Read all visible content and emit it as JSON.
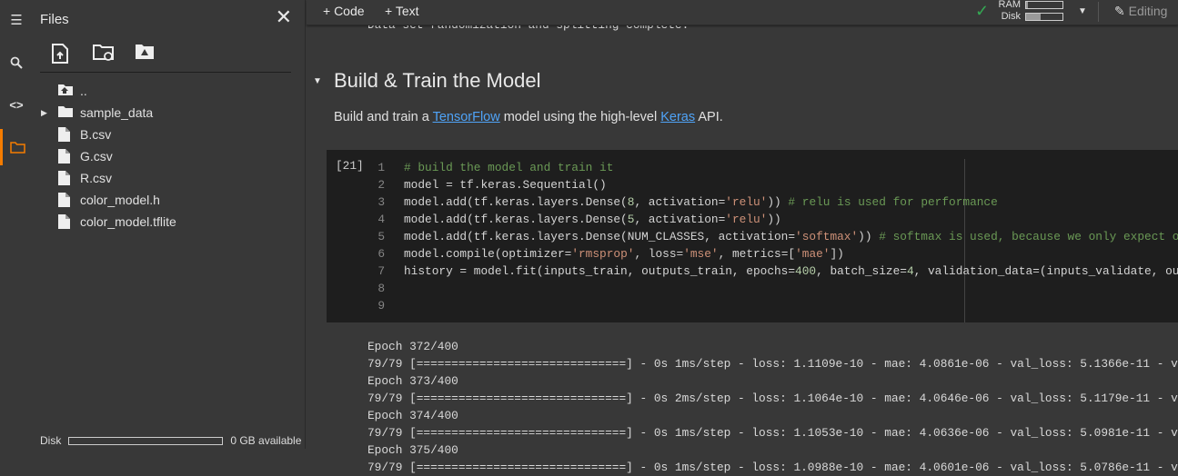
{
  "rail": {
    "icons": [
      "menu-icon",
      "search-icon",
      "code-icon",
      "folder-icon"
    ]
  },
  "files": {
    "title": "Files",
    "items": [
      {
        "name": "..",
        "type": "parent"
      },
      {
        "name": "sample_data",
        "type": "folder"
      },
      {
        "name": "B.csv",
        "type": "file"
      },
      {
        "name": "G.csv",
        "type": "file"
      },
      {
        "name": "R.csv",
        "type": "file"
      },
      {
        "name": "color_model.h",
        "type": "file"
      },
      {
        "name": "color_model.tflite",
        "type": "file"
      }
    ],
    "disk_label": "Disk",
    "disk_available": "0 GB available",
    "disk_used_fraction": 0
  },
  "toolbar": {
    "add_code": "+ Code",
    "add_text": "+ Text",
    "ram_label": "RAM",
    "disk_label": "Disk",
    "ram_fraction": 0.05,
    "disk_fraction": 0.4,
    "editing": "Editing",
    "status_color": "#34a853"
  },
  "notebook": {
    "prev_output": "Data set randomization and splitting complete.",
    "heading": "Build & Train the Model",
    "para": {
      "before": "Build and train a ",
      "link1": "TensorFlow",
      "middle": " model using the high-level ",
      "link2": "Keras",
      "after": " API."
    },
    "cell": {
      "exec_count": "[21]",
      "lines": [
        [
          [
            "c",
            "# build the model and train it"
          ]
        ],
        [
          [
            "t",
            "model = tf.keras.Sequential()"
          ]
        ],
        [
          [
            "t",
            "model.add(tf.keras.layers.Dense("
          ],
          [
            "n",
            "8"
          ],
          [
            "t",
            ", activation="
          ],
          [
            "s",
            "'relu'"
          ],
          [
            "t",
            ")) "
          ],
          [
            "c",
            "# relu is used for performance"
          ]
        ],
        [
          [
            "t",
            "model.add(tf.keras.layers.Dense("
          ],
          [
            "n",
            "5"
          ],
          [
            "t",
            ", activation="
          ],
          [
            "s",
            "'relu'"
          ],
          [
            "t",
            "))"
          ]
        ],
        [
          [
            "t",
            "model.add(tf.keras.layers.Dense(NUM_CLASSES, activation="
          ],
          [
            "s",
            "'softmax'"
          ],
          [
            "t",
            ")) "
          ],
          [
            "c",
            "# softmax is used, because we only expect o"
          ]
        ],
        [
          [
            "t",
            "model.compile(optimizer="
          ],
          [
            "s",
            "'rmsprop'"
          ],
          [
            "t",
            ", loss="
          ],
          [
            "s",
            "'mse'"
          ],
          [
            "t",
            ", metrics=["
          ],
          [
            "s",
            "'mae'"
          ],
          [
            "t",
            "])"
          ]
        ],
        [
          [
            "t",
            "history = model.fit(inputs_train, outputs_train, epochs="
          ],
          [
            "n",
            "400"
          ],
          [
            "t",
            ", batch_size="
          ],
          [
            "n",
            "4"
          ],
          [
            "t",
            ", validation_data=(inputs_validate, ou"
          ]
        ],
        [],
        []
      ]
    },
    "output": [
      "Epoch 372/400",
      "79/79 [==============================] - 0s 1ms/step - loss: 1.1109e-10 - mae: 4.0861e-06 - val_loss: 5.1366e-11 - v",
      "Epoch 373/400",
      "79/79 [==============================] - 0s 2ms/step - loss: 1.1064e-10 - mae: 4.0646e-06 - val_loss: 5.1179e-11 - v",
      "Epoch 374/400",
      "79/79 [==============================] - 0s 1ms/step - loss: 1.1053e-10 - mae: 4.0636e-06 - val_loss: 5.0981e-11 - v",
      "Epoch 375/400",
      "79/79 [==============================] - 0s 1ms/step - loss: 1.0988e-10 - mae: 4.0601e-06 - val_loss: 5.0786e-11 - v"
    ]
  }
}
